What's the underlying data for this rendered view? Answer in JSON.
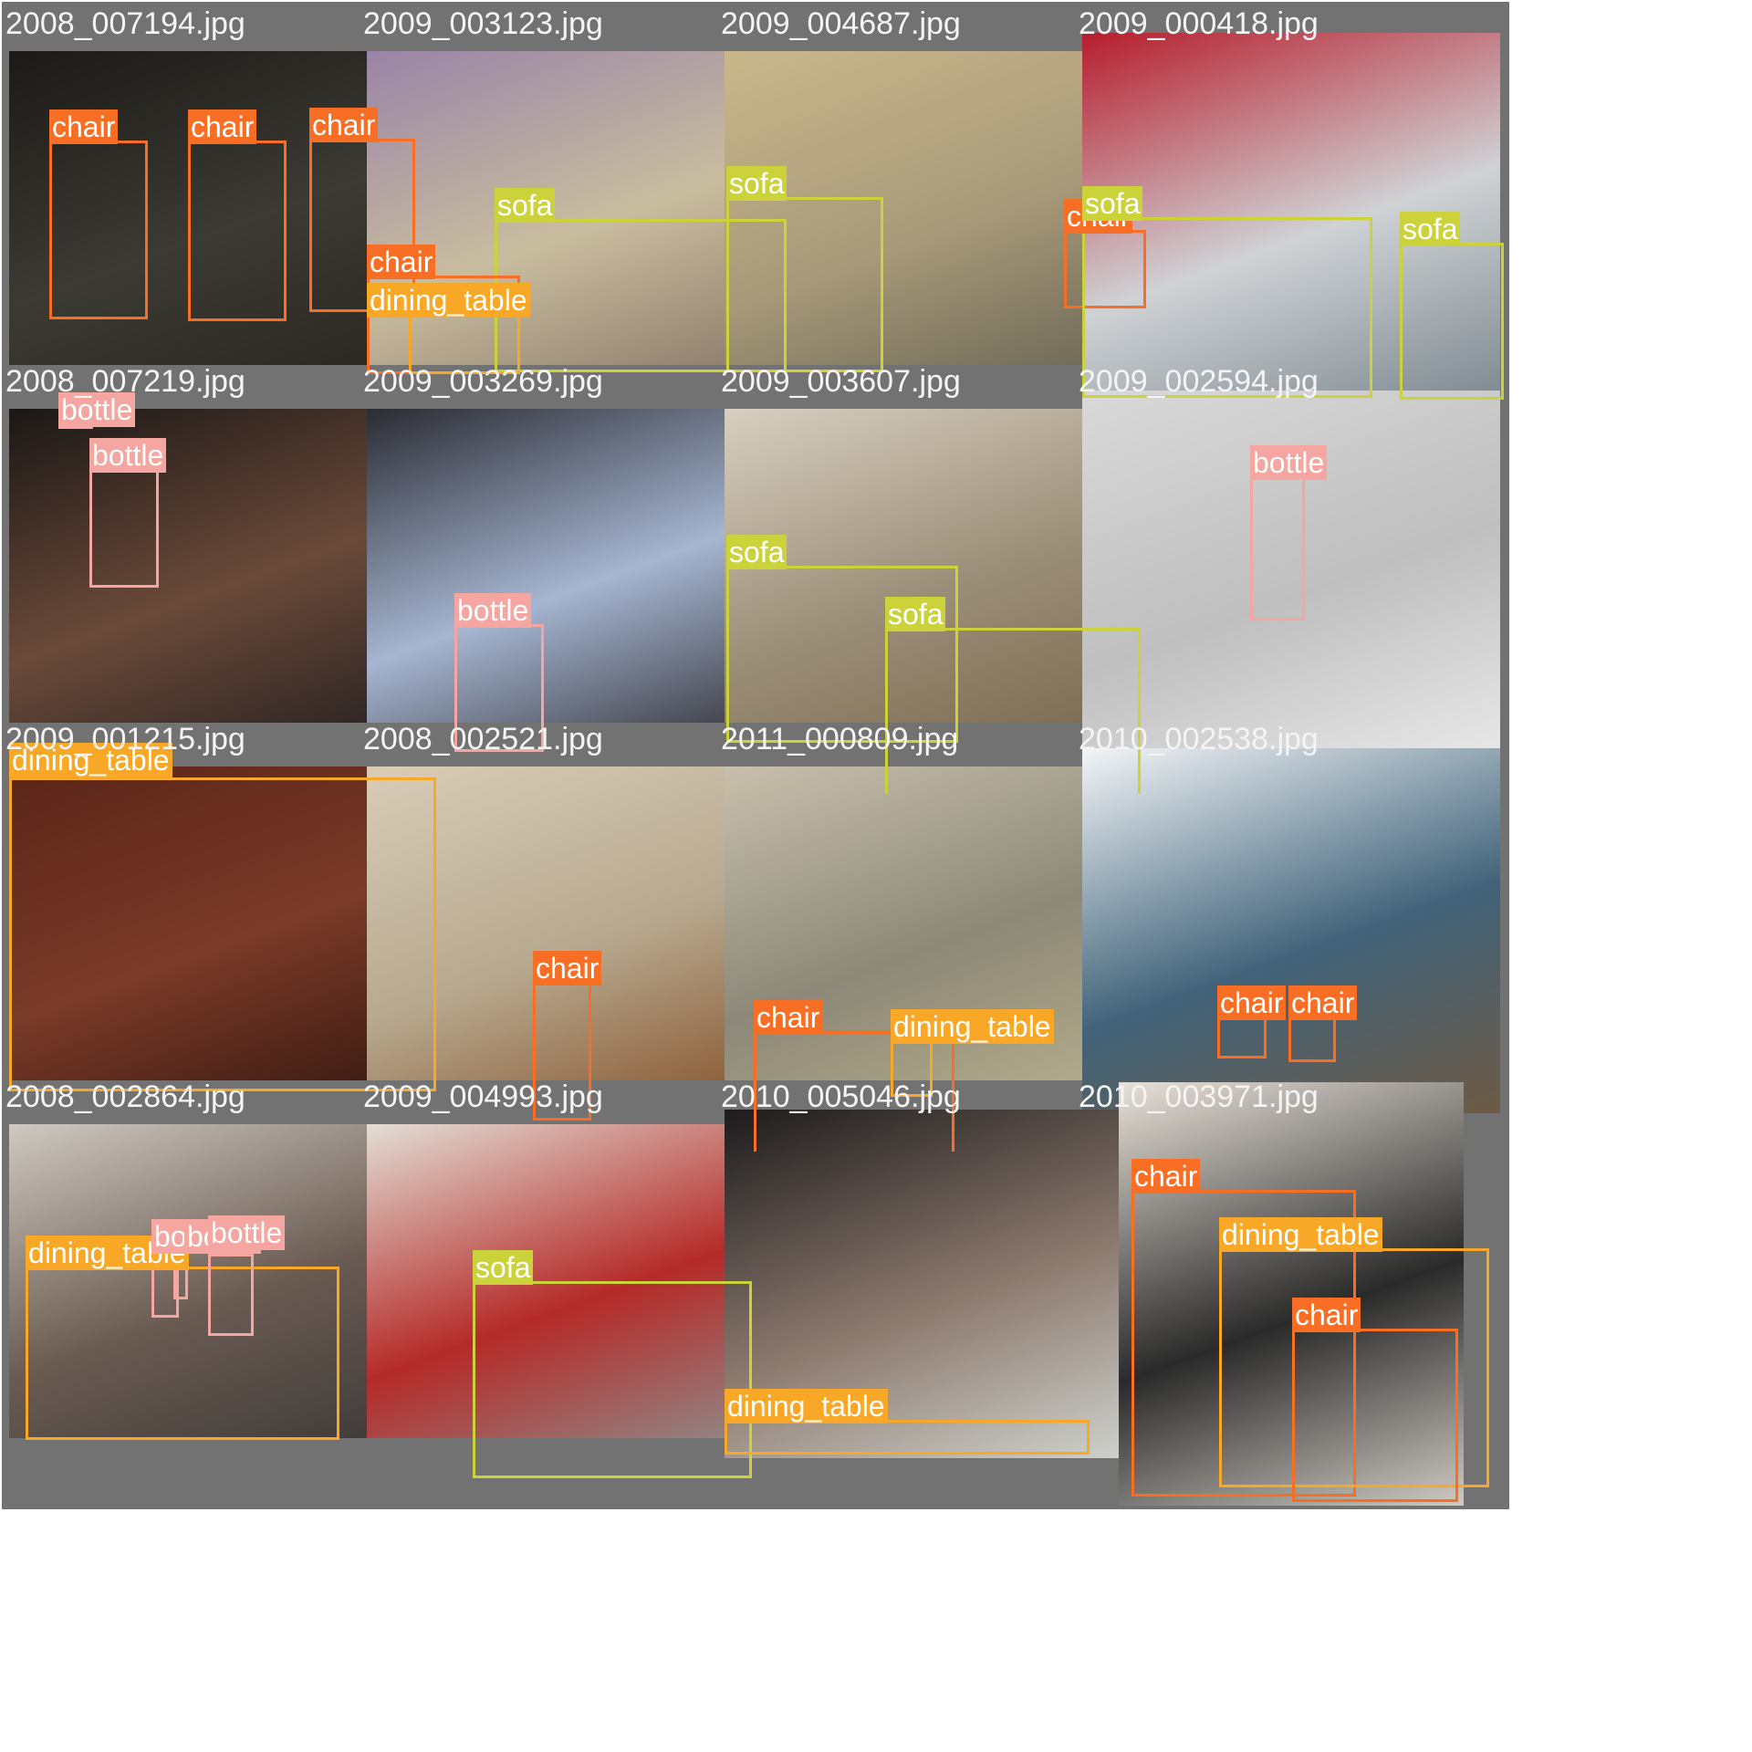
{
  "class_colors": {
    "chair": "#f86e24",
    "sofa": "#cbd23a",
    "dining_table": "#f8a726",
    "bottle": "#f5a6a0"
  },
  "tiles": [
    {
      "filename": "2008_007194.jpg",
      "photo_tone": [
        "#1c1a17",
        "#3b3a33",
        "#2a2720"
      ],
      "detections": [
        {
          "label": "chair"
        },
        {
          "label": "chair"
        },
        {
          "label": "chair"
        }
      ]
    },
    {
      "filename": "2009_003123.jpg",
      "photo_tone": [
        "#9a84a7",
        "#c9bd9f",
        "#8c7a6a"
      ],
      "detections": [
        {
          "label": "sofa"
        },
        {
          "label": "chair"
        },
        {
          "label": "dining_table"
        }
      ]
    },
    {
      "filename": "2009_004687.jpg",
      "photo_tone": [
        "#c9b78b",
        "#a89a7a",
        "#6b6655"
      ],
      "detections": [
        {
          "label": "sofa"
        },
        {
          "label": "chair"
        }
      ]
    },
    {
      "filename": "2009_000418.jpg",
      "photo_tone": [
        "#b71d2d",
        "#cfd2d5",
        "#7f8a91"
      ],
      "detections": [
        {
          "label": "sofa"
        },
        {
          "label": "sofa"
        }
      ]
    },
    {
      "filename": "2008_007219.jpg",
      "photo_tone": [
        "#1b1716",
        "#6a4a3a",
        "#2a2322"
      ],
      "detections": [
        {
          "label": "bottle"
        },
        {
          "label": "bottle"
        }
      ]
    },
    {
      "filename": "2009_003269.jpg",
      "photo_tone": [
        "#2b2c33",
        "#a6b5d1",
        "#3a3a40"
      ],
      "detections": [
        {
          "label": "bottle"
        }
      ]
    },
    {
      "filename": "2009_003607.jpg",
      "photo_tone": [
        "#d8cfc1",
        "#9c8f79",
        "#7b6b4f"
      ],
      "detections": [
        {
          "label": "sofa"
        },
        {
          "label": "sofa"
        }
      ]
    },
    {
      "filename": "2009_002594.jpg",
      "photo_tone": [
        "#d9d9d9",
        "#bfbfbf",
        "#e8e8e8"
      ],
      "detections": [
        {
          "label": "bottle"
        }
      ]
    },
    {
      "filename": "2009_001215.jpg",
      "photo_tone": [
        "#5a2418",
        "#7a3a28",
        "#3a1a12"
      ],
      "detections": [
        {
          "label": "dining_table"
        }
      ]
    },
    {
      "filename": "2008_002521.jpg",
      "photo_tone": [
        "#d9cdb8",
        "#b7a98f",
        "#8a5a35"
      ],
      "detections": [
        {
          "label": "chair"
        }
      ]
    },
    {
      "filename": "2011_000809.jpg",
      "photo_tone": [
        "#c8c0ad",
        "#8d8878",
        "#b5ad8c"
      ],
      "detections": [
        {
          "label": "chair"
        },
        {
          "label": "dining_table"
        }
      ]
    },
    {
      "filename": "2010_002538.jpg",
      "photo_tone": [
        "#f3f5f7",
        "#41637a",
        "#6e5a45"
      ],
      "detections": [
        {
          "label": "chair"
        },
        {
          "label": "chair"
        }
      ]
    },
    {
      "filename": "2008_002864.jpg",
      "photo_tone": [
        "#cfc9c1",
        "#6a5b52",
        "#3d3a38"
      ],
      "detections": [
        {
          "label": "dining_table"
        },
        {
          "label": "bottle"
        },
        {
          "label": "bottle"
        },
        {
          "label": "bottle"
        }
      ]
    },
    {
      "filename": "2009_004993.jpg",
      "photo_tone": [
        "#e3ded6",
        "#b52a28",
        "#8e8d8c"
      ],
      "detections": [
        {
          "label": "sofa"
        }
      ]
    },
    {
      "filename": "2010_005046.jpg",
      "photo_tone": [
        "#1d1b1c",
        "#8d7a6f",
        "#cfd4cf"
      ],
      "detections": [
        {
          "label": "dining_table"
        }
      ]
    },
    {
      "filename": "2010_003971.jpg",
      "photo_tone": [
        "#e8e1d8",
        "#2a2a2a",
        "#cfcac2"
      ],
      "detections": [
        {
          "label": "chair"
        },
        {
          "label": "dining_table"
        },
        {
          "label": "chair"
        }
      ]
    }
  ]
}
